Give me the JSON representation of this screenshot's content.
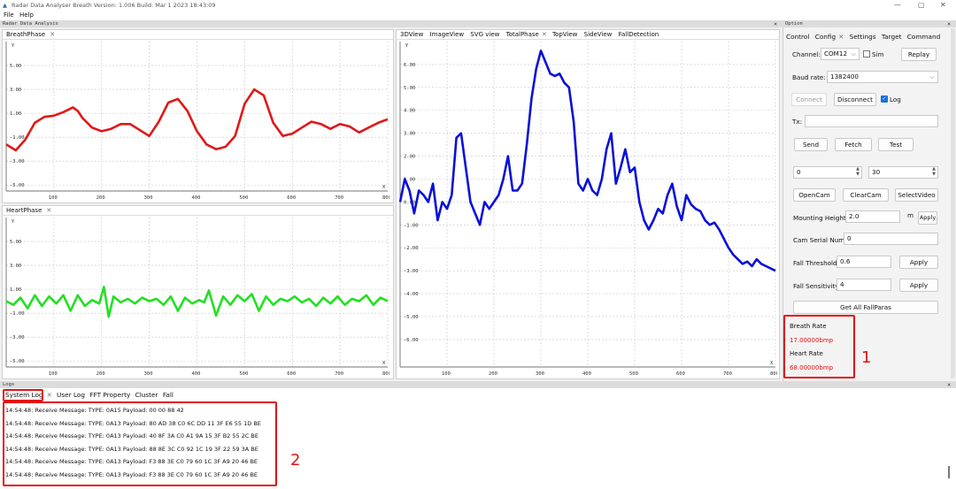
{
  "window": {
    "title": "Radar Data Analyser Breath Version: 1.006 Build: Mar  1 2023 18:43:09",
    "minimize": "—",
    "maximize": "▢",
    "close": "✕"
  },
  "menu": [
    "File",
    "Help"
  ],
  "radar_dock": {
    "title": "Radar Data Analysis",
    "close": "✕"
  },
  "breath_panel": {
    "tab": "BreathPhase",
    "close": "✕"
  },
  "heart_panel": {
    "tab": "HeartPhase",
    "close": "✕"
  },
  "view_tabs": [
    "3DView",
    "ImageView",
    "SVG view",
    "TotalPhase",
    "TopView",
    "SideView",
    "FallDetection"
  ],
  "option_dock": {
    "title": "Option",
    "close": "✕"
  },
  "option_tabs": [
    "Control",
    "Config",
    "Settings",
    "Target",
    "Command"
  ],
  "config": {
    "channel_label": "Channel:",
    "channel_value": "COM12",
    "sim_label": "Sim",
    "replay": "Replay",
    "baud_label": "Baud rate:",
    "baud_value": "1382400",
    "connect": "Connect",
    "disconnect": "Disconnect",
    "log_label": "Log",
    "tx_label": "Tx:",
    "send": "Send",
    "fetch": "Fetch",
    "test": "Test",
    "spin1": "0",
    "spin2": "30",
    "opencam": "OpenCam",
    "clearcam": "ClearCam",
    "selectvideo": "SelectVideo",
    "mount_label": "Mounting Height",
    "mount_value": "2.0",
    "mount_unit": "m",
    "apply": "Apply",
    "cam_label": "Cam Serial Num",
    "cam_value": "0",
    "fall_thr_label": "Fall Threshold",
    "fall_thr_value": "0.6",
    "fall_sens_label": "Fall Sensitivity",
    "fall_sens_value": "4",
    "get_all": "Get All FallParas",
    "breath_rate_label": "Breath Rate",
    "breath_rate_value": "17.00000bmp",
    "heart_rate_label": "Heart Rate",
    "heart_rate_value": "68.00000bmp"
  },
  "annotations": {
    "one": "1",
    "two": "2"
  },
  "logs": {
    "title": "Logs",
    "close": "✕",
    "tabs": [
      "System Log",
      "User Log",
      "FFT Property",
      "Cluster",
      "Fall"
    ],
    "lines": [
      "14:54:48: Receive Message: TYPE: 0A15 Payload: 00 00 88 42",
      "14:54:48: Receive Message: TYPE: 0A13 Payload: 80 AD 38 C0 6C DD 11 3F E6 55 1D BE",
      "14:54:48: Receive Message: TYPE: 0A13 Payload: 40 8F 3A C0 A1 9A 15 3F B2 55 2C BE",
      "14:54:48: Receive Message: TYPE: 0A13 Payload: 88 8E 3C C0 92 1C 19 3F 22 59 3A BE",
      "14:54:48: Receive Message: TYPE: 0A13 Payload: F3 88 3E C0 79 60 1C 3F A9 20 46 BE",
      "14:54:48: Receive Message: TYPE: 0A13 Payload: F3 88 3E C0 79 60 1C 3F A9 20 46 BE"
    ]
  },
  "colors": {
    "breath": "#e01818",
    "heart": "#22e022",
    "total": "#0a10d8",
    "annotation": "#e21212",
    "rate_value": "#e21212"
  },
  "chart_data": [
    {
      "type": "line",
      "name": "BreathPhase",
      "xlabel": "X",
      "ylabel": "Y",
      "xlim": [
        0,
        800
      ],
      "ylim": [
        -5.5,
        7.0
      ],
      "xticks": [
        100,
        200,
        300,
        400,
        500,
        600,
        700,
        800
      ],
      "yticks": [
        5.0,
        3.0,
        1.0,
        -1.0,
        -3.0,
        -5.0
      ],
      "x": [
        0,
        20,
        40,
        60,
        80,
        100,
        120,
        140,
        150,
        160,
        180,
        200,
        220,
        240,
        260,
        280,
        300,
        320,
        340,
        360,
        380,
        400,
        420,
        440,
        460,
        480,
        500,
        520,
        540,
        560,
        580,
        600,
        620,
        640,
        660,
        680,
        700,
        720,
        740,
        760,
        780,
        800
      ],
      "series": [
        {
          "values": [
            -1.6,
            -2.1,
            -1.2,
            0.2,
            0.7,
            0.8,
            1.1,
            1.5,
            1.2,
            0.6,
            -0.2,
            -0.5,
            -0.3,
            0.1,
            0.1,
            -0.4,
            -0.9,
            0.3,
            1.9,
            2.2,
            1.2,
            -0.5,
            -1.6,
            -2.0,
            -1.8,
            -0.9,
            1.8,
            3.0,
            2.5,
            0.2,
            -0.9,
            -0.7,
            -0.2,
            0.3,
            0.1,
            -0.3,
            0.1,
            -0.1,
            -0.6,
            -0.2,
            0.2,
            0.5
          ]
        }
      ]
    },
    {
      "type": "line",
      "name": "HeartPhase",
      "xlabel": "X",
      "ylabel": "Y",
      "xlim": [
        0,
        800
      ],
      "ylim": [
        -5.5,
        7.0
      ],
      "xticks": [
        100,
        200,
        300,
        400,
        500,
        600,
        700,
        800
      ],
      "yticks": [
        5.0,
        3.0,
        1.0,
        -1.0,
        -3.0,
        -5.0
      ],
      "x": [
        0,
        15,
        30,
        45,
        60,
        75,
        90,
        105,
        120,
        135,
        150,
        165,
        180,
        195,
        205,
        215,
        225,
        240,
        255,
        270,
        285,
        300,
        315,
        330,
        345,
        360,
        375,
        390,
        405,
        415,
        425,
        440,
        455,
        470,
        485,
        500,
        515,
        530,
        545,
        560,
        575,
        590,
        605,
        620,
        635,
        650,
        665,
        680,
        695,
        710,
        725,
        740,
        755,
        770,
        785,
        800
      ],
      "series": [
        {
          "values": [
            0.0,
            -0.3,
            0.3,
            -0.6,
            0.5,
            -0.4,
            0.4,
            -0.2,
            0.5,
            -0.8,
            0.5,
            -0.4,
            0.1,
            -0.2,
            1.2,
            -1.3,
            0.4,
            -0.1,
            0.2,
            -0.2,
            0.3,
            0.0,
            0.2,
            -0.3,
            0.4,
            -0.8,
            0.3,
            -0.2,
            0.1,
            -0.1,
            0.9,
            -1.2,
            0.4,
            -0.3,
            0.5,
            0.0,
            0.6,
            -0.8,
            0.4,
            -0.3,
            0.2,
            0.0,
            0.4,
            -0.1,
            0.2,
            -0.4,
            0.3,
            -0.2,
            0.4,
            -0.3,
            0.2,
            0.0,
            0.5,
            -0.3,
            0.3,
            0.0
          ]
        }
      ]
    },
    {
      "type": "line",
      "name": "TotalPhase",
      "xlabel": "X",
      "ylabel": "Y",
      "xlim": [
        0,
        800
      ],
      "ylim": [
        -7.2,
        7.0
      ],
      "xticks": [
        100,
        200,
        300,
        400,
        500,
        600,
        700,
        800
      ],
      "yticks": [
        6.0,
        5.0,
        4.0,
        3.0,
        2.0,
        1.0,
        0.0,
        -1.0,
        -2.0,
        -3.0,
        -4.0,
        -5.0,
        -6.0
      ],
      "x": [
        0,
        10,
        20,
        30,
        40,
        50,
        60,
        70,
        80,
        90,
        100,
        110,
        120,
        130,
        140,
        150,
        160,
        170,
        180,
        190,
        200,
        210,
        220,
        230,
        240,
        250,
        260,
        270,
        280,
        290,
        300,
        310,
        320,
        330,
        340,
        350,
        360,
        370,
        380,
        390,
        400,
        410,
        420,
        430,
        440,
        450,
        460,
        470,
        480,
        490,
        500,
        510,
        520,
        530,
        540,
        550,
        560,
        570,
        580,
        590,
        600,
        610,
        620,
        630,
        640,
        650,
        660,
        670,
        680,
        690,
        700,
        710,
        720,
        730,
        740,
        750,
        760,
        770,
        780,
        790,
        800
      ],
      "series": [
        {
          "values": [
            0.0,
            1.0,
            0.5,
            -0.5,
            0.5,
            0.3,
            0.0,
            0.8,
            -0.8,
            0.0,
            -0.3,
            0.3,
            2.8,
            3.0,
            1.5,
            0.0,
            -0.5,
            -1.0,
            0.0,
            -0.3,
            0.0,
            0.3,
            1.0,
            2.0,
            0.5,
            0.5,
            0.8,
            2.5,
            4.5,
            5.8,
            6.6,
            6.1,
            5.6,
            5.5,
            5.6,
            5.2,
            5.0,
            3.5,
            0.8,
            0.5,
            1.0,
            0.5,
            0.3,
            1.0,
            2.3,
            3.0,
            0.8,
            1.5,
            2.3,
            1.3,
            1.5,
            0.0,
            -0.8,
            -1.2,
            -0.8,
            -0.3,
            -0.5,
            0.3,
            0.8,
            -0.2,
            -0.8,
            0.3,
            -0.1,
            -0.3,
            -0.4,
            -0.8,
            -1.0,
            -0.9,
            -1.2,
            -1.6,
            -2.0,
            -2.3,
            -2.5,
            -2.7,
            -2.6,
            -2.8,
            -2.5,
            -2.7,
            -2.8,
            -2.9,
            -3.0
          ]
        }
      ]
    }
  ]
}
